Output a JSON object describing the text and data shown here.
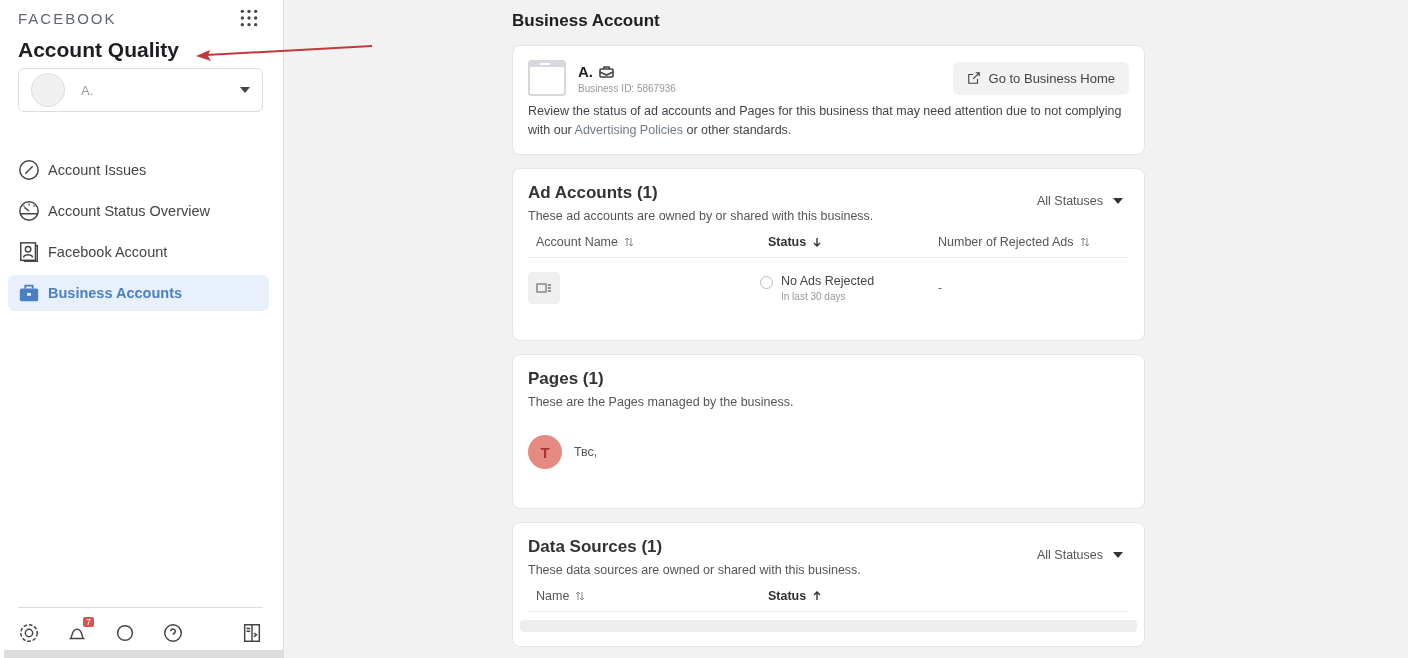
{
  "sidebar": {
    "brand": "FACEBOOK",
    "title": "Account Quality",
    "account_select": {
      "value": "A."
    },
    "items": [
      {
        "label": "Account Issues",
        "kind": "issues",
        "selected": false
      },
      {
        "label": "Account Status Overview",
        "kind": "gauge",
        "selected": false
      },
      {
        "label": "Facebook Account",
        "kind": "profile",
        "selected": false
      },
      {
        "label": "Business Accounts",
        "kind": "briefcase",
        "selected": true
      }
    ],
    "footer": {
      "notification_badge": "7"
    }
  },
  "main": {
    "title": "Business Account",
    "business": {
      "name": "A.",
      "business_id": "Business ID: 5867936",
      "button": "Go to Business Home",
      "description": "Review the status of ad accounts and Pages for this business that may need attention due to not complying with our ",
      "link": "Advertising Policies",
      "description_end": " or other standards."
    },
    "ad_accounts": {
      "title": "Ad Accounts (1)",
      "subtitle": "These ad accounts are owned by or shared with this business.",
      "filter": "All Statuses",
      "columns": [
        {
          "label": "Account Name",
          "kind": "sortable"
        },
        {
          "label": "Status",
          "kind": "descending"
        },
        {
          "label": "Number of Rejected Ads",
          "kind": "sortable"
        }
      ],
      "rows": [
        {
          "checked": false,
          "status": "No Ads Rejected",
          "status_note": "In last 30 days",
          "rejected": "-"
        }
      ]
    },
    "pages": {
      "title": "Pages (1)",
      "subtitle": "These are the Pages managed by the business.",
      "items": [
        {
          "initial": "T",
          "name": "Твс,"
        }
      ]
    },
    "data_sources": {
      "title": "Data Sources (1)",
      "subtitle": "These data sources are owned or shared with this business.",
      "filter": "All Statuses",
      "columns": [
        {
          "label": "Name",
          "kind": "sortable"
        },
        {
          "label": "Status",
          "kind": "ascending"
        }
      ]
    }
  }
}
